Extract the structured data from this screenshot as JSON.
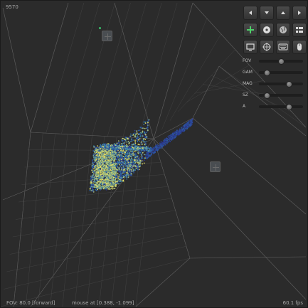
{
  "viewer": {
    "counter": "9570",
    "status": {
      "fov": "FOV: 80.0 [forward]",
      "mouse": "mouse at [0.388, -1.099]",
      "fps": "60.1 fps"
    }
  },
  "toolbar": {
    "row1": [
      "arrow-left-icon",
      "arrow-down-icon",
      "arrow-up-icon",
      "arrow-right-icon"
    ],
    "row2": [
      "add-icon",
      "disc-icon",
      "globe-icon",
      "grid-view-icon"
    ],
    "row3": [
      "monitor-icon",
      "crosshair-icon",
      "keyboard-icon",
      "mouse-icon"
    ]
  },
  "sliders": [
    {
      "label": "FOV",
      "value": 0.5
    },
    {
      "label": "GAM",
      "value": 0.18
    },
    {
      "label": "MAG",
      "value": 0.68
    },
    {
      "label": "SZ",
      "value": 0.18
    },
    {
      "label": "A",
      "value": 0.68
    }
  ],
  "colors": {
    "background": "#2b2b2b",
    "points_low": "#2a2a8a",
    "points_mid": "#2f7fb0",
    "points_high": "#f2e45a",
    "handle_marker": "#3ac16a"
  }
}
